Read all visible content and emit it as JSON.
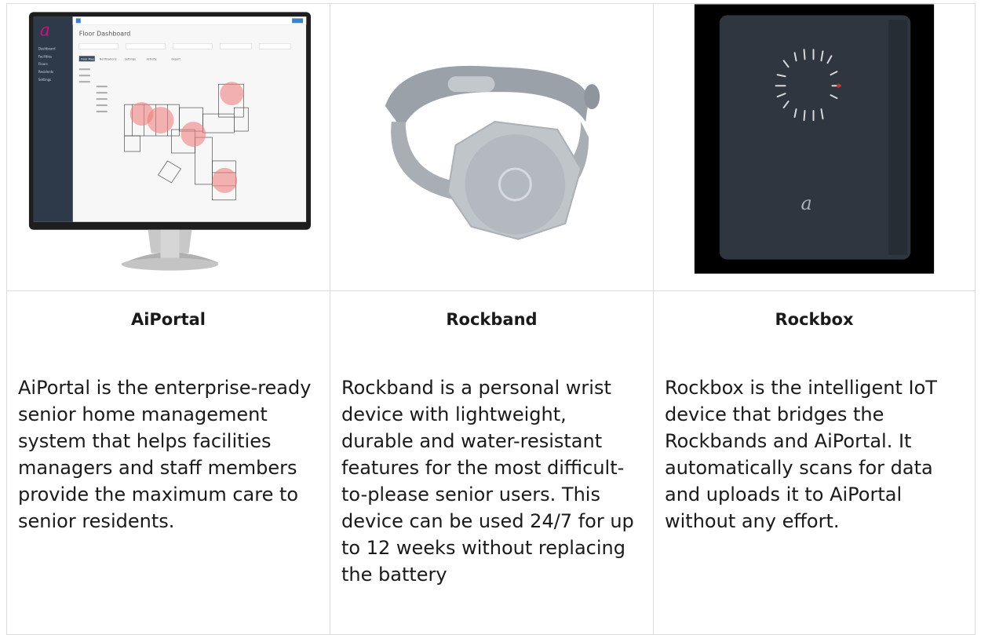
{
  "products": [
    {
      "name": "AiPortal",
      "description": "AiPortal is the enterprise-ready senior home management system that helps facilities managers and staff members provide the maximum care to senior residents.",
      "screen": {
        "logo_letter": "a",
        "dashboard_title": "Floor Dashboard",
        "nav_items": [
          "Dashboard",
          "Facilities",
          "Floors",
          "Residents",
          "Settings"
        ],
        "tabs": [
          "Floor Map",
          "Notifications",
          "Settings",
          "Activity",
          "Export"
        ]
      }
    },
    {
      "name": "Rockband",
      "description": "Rockband is a personal wrist device with lightweight, durable and water-resistant features for the most difficult-to-please senior users. This device can be used 24/7 for up to 12 weeks without replacing the battery"
    },
    {
      "name": "Rockbox",
      "description": "Rockbox is the intelligent IoT device that bridges the Rockbands and AiPortal. It automatically scans for data and uploads it to AiPortal without any effort.",
      "logo_letter": "a"
    }
  ],
  "colors": {
    "border": "#dcdcdc",
    "portal_sidebar": "#2e3a4a",
    "heat": "#f08080",
    "band": "#9aa1a8",
    "box": "#2f3640"
  }
}
